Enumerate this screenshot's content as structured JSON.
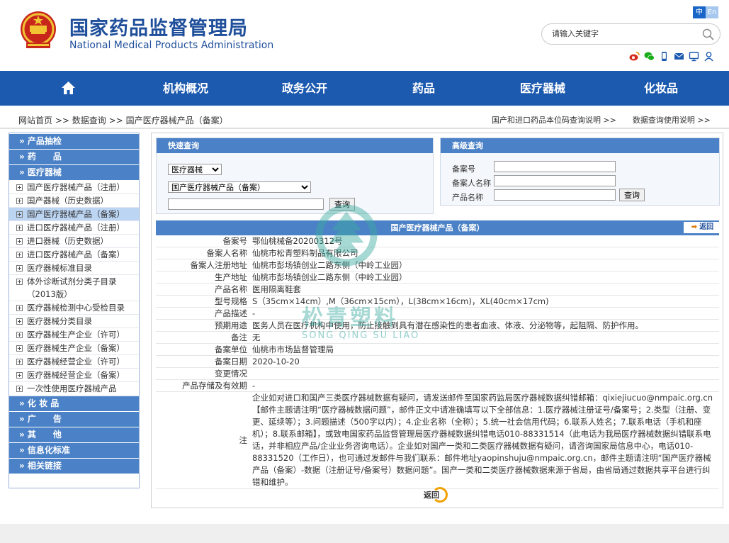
{
  "header": {
    "title_cn": "国家药品监督管理局",
    "title_en": "National Medical Products Administration",
    "lang_zh": "中",
    "lang_en": "En",
    "search_placeholder": "请输入关键字"
  },
  "nav": [
    "机构概况",
    "政务公开",
    "药品",
    "医疗器械",
    "化妆品"
  ],
  "breadcrumb": {
    "home": "网站首页",
    "sep": ">>",
    "data": "数据查询",
    "current": "国产医疗器械产品（备案）",
    "right1": "国产和进口药品本位码查询说明 >>",
    "right2": "数据查询使用说明 >>"
  },
  "sidebar": {
    "cats_top": [
      "» 产品抽检",
      "» 药　　品",
      "» 医疗器械"
    ],
    "items": [
      "国产医疗器械产品（注册）",
      "国产器械（历史数据）",
      "国产医疗器械产品（备案）",
      "进口医疗器械产品（注册）",
      "进口器械（历史数据）",
      "进口医疗器械产品（备案）",
      "医疗器械标准目录",
      "体外诊断试剂分类子目录（2013版）",
      "医疗器械检测中心受检目录",
      "医疗器械分类目录",
      "医疗器械生产企业（许可）",
      "医疗器械生产企业（备案）",
      "医疗器械经营企业（许可）",
      "医疗器械经营企业（备案）",
      "一次性使用医疗器械产品"
    ],
    "active_index": 2,
    "cats_bottom": [
      "» 化 妆 品",
      "» 广　　告",
      "» 其　　他",
      "» 信息化标准",
      "» 相关链接"
    ]
  },
  "quick": {
    "title": "快速查询",
    "select1": "医疗器械",
    "select2": "国产医疗器械产品（备案）",
    "button": "查询"
  },
  "advanced": {
    "title": "高级查询",
    "label1": "备案号",
    "label2": "备案人名称",
    "label3": "产品名称",
    "button": "查询"
  },
  "result": {
    "title": "国产医疗器械产品（备案）",
    "back": "返回",
    "rows": [
      {
        "k": "备案号",
        "v": "鄂仙桃械备20200312号"
      },
      {
        "k": "备案人名称",
        "v": "仙桃市松青塑料制品有限公司"
      },
      {
        "k": "备案人注册地址",
        "v": "仙桃市彭场镇创业二路东侧（中岭工业园）"
      },
      {
        "k": "生产地址",
        "v": "仙桃市彭场镇创业二路东侧（中岭工业园）"
      },
      {
        "k": "产品名称",
        "v": "医用隔离鞋套"
      },
      {
        "k": "型号规格",
        "v": "S（35cm×14cm）,M（36cm×15cm），L(38cm×16cm)，XL(40cm×17cm)"
      },
      {
        "k": "产品描述",
        "v": "-"
      },
      {
        "k": "预期用途",
        "v": "医务人员在医疗机构中使用，防止接触到具有潜在感染性的患者血液、体液、分泌物等，起阻隔、防护作用。"
      },
      {
        "k": "备注",
        "v": "无"
      },
      {
        "k": "备案单位",
        "v": "仙桃市市场监督管理局"
      },
      {
        "k": "备案日期",
        "v": "2020-10-20"
      },
      {
        "k": "变更情况",
        "v": ""
      },
      {
        "k": "产品存储及有效期",
        "v": "-"
      }
    ],
    "note_key": "注",
    "note": "企业如对进口和国产三类医疗器械数据有疑问，请发送邮件至国家药监局医疗器械数据纠错邮箱：qixiejiucuo@nmpaic.org.cn【邮件主题请注明“医疗器械数据问题”，邮件正文中请准确填写以下全部信息：1.医疗器械注册证号/备案号；2.类型（注册、变更、延续等）；3.问题描述（500字以内）；4.企业名称（全称）；5.统一社会信用代码；6.联系人姓名；7.联系电话（手机和座机）；8.联系邮箱】，或致电国家药品监督管理局医疗器械数据纠错电话010-88331514（此电话为我局医疗器械数据纠错联系电话，并非相应产品/企业业务咨询电话）。企业如对国产一类和二类医疗器械数据有疑问，请咨询国家局信息中心，电话010-88331520（工作日），也可通过发邮件与我们联系：邮件地址yaopinshuju@nmpaic.org.cn，邮件主题请注明“国产医疗器械产品（备案）-数据（注册证号/备案号）数据问题”。国产一类和二类医疗器械数据来源于省局，由省局通过数据共享平台进行纠错和维护。",
    "bottom_back": "返回"
  },
  "watermark": {
    "cn": "松青塑料",
    "en": "SONG QING SU LIAO"
  },
  "colors": {
    "brand": "#1f4f9b",
    "nav": "#1c5aaf",
    "panel": "#4b81c6",
    "active": "#bcd5f3"
  }
}
